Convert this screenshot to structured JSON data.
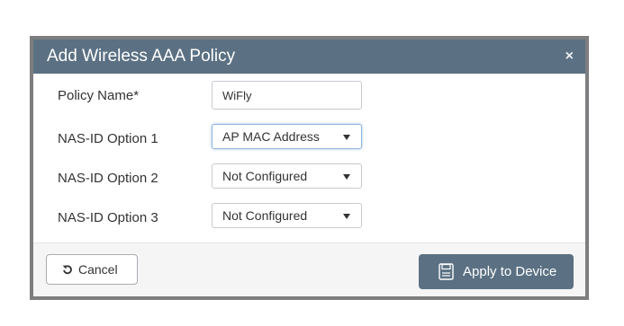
{
  "dialog": {
    "title": "Add Wireless AAA Policy",
    "close_symbol": "×"
  },
  "form": {
    "policy_name": {
      "label": "Policy Name*",
      "value": "WiFly"
    },
    "nas_id_option_1": {
      "label": "NAS-ID Option 1",
      "selected": "AP MAC Address"
    },
    "nas_id_option_2": {
      "label": "NAS-ID Option 2",
      "selected": "Not Configured"
    },
    "nas_id_option_3": {
      "label": "NAS-ID Option 3",
      "selected": "Not Configured"
    }
  },
  "footer": {
    "cancel_label": "Cancel",
    "apply_label": "Apply to Device"
  },
  "icons": {
    "close": "close-icon",
    "caret": "caret-down-icon",
    "cancel": "undo-icon",
    "apply": "save-icon"
  },
  "colors": {
    "header": "#5b7183",
    "primary_button": "#5b7183",
    "modal_border": "#7e7e80",
    "footer_background": "#f5f5f5"
  }
}
